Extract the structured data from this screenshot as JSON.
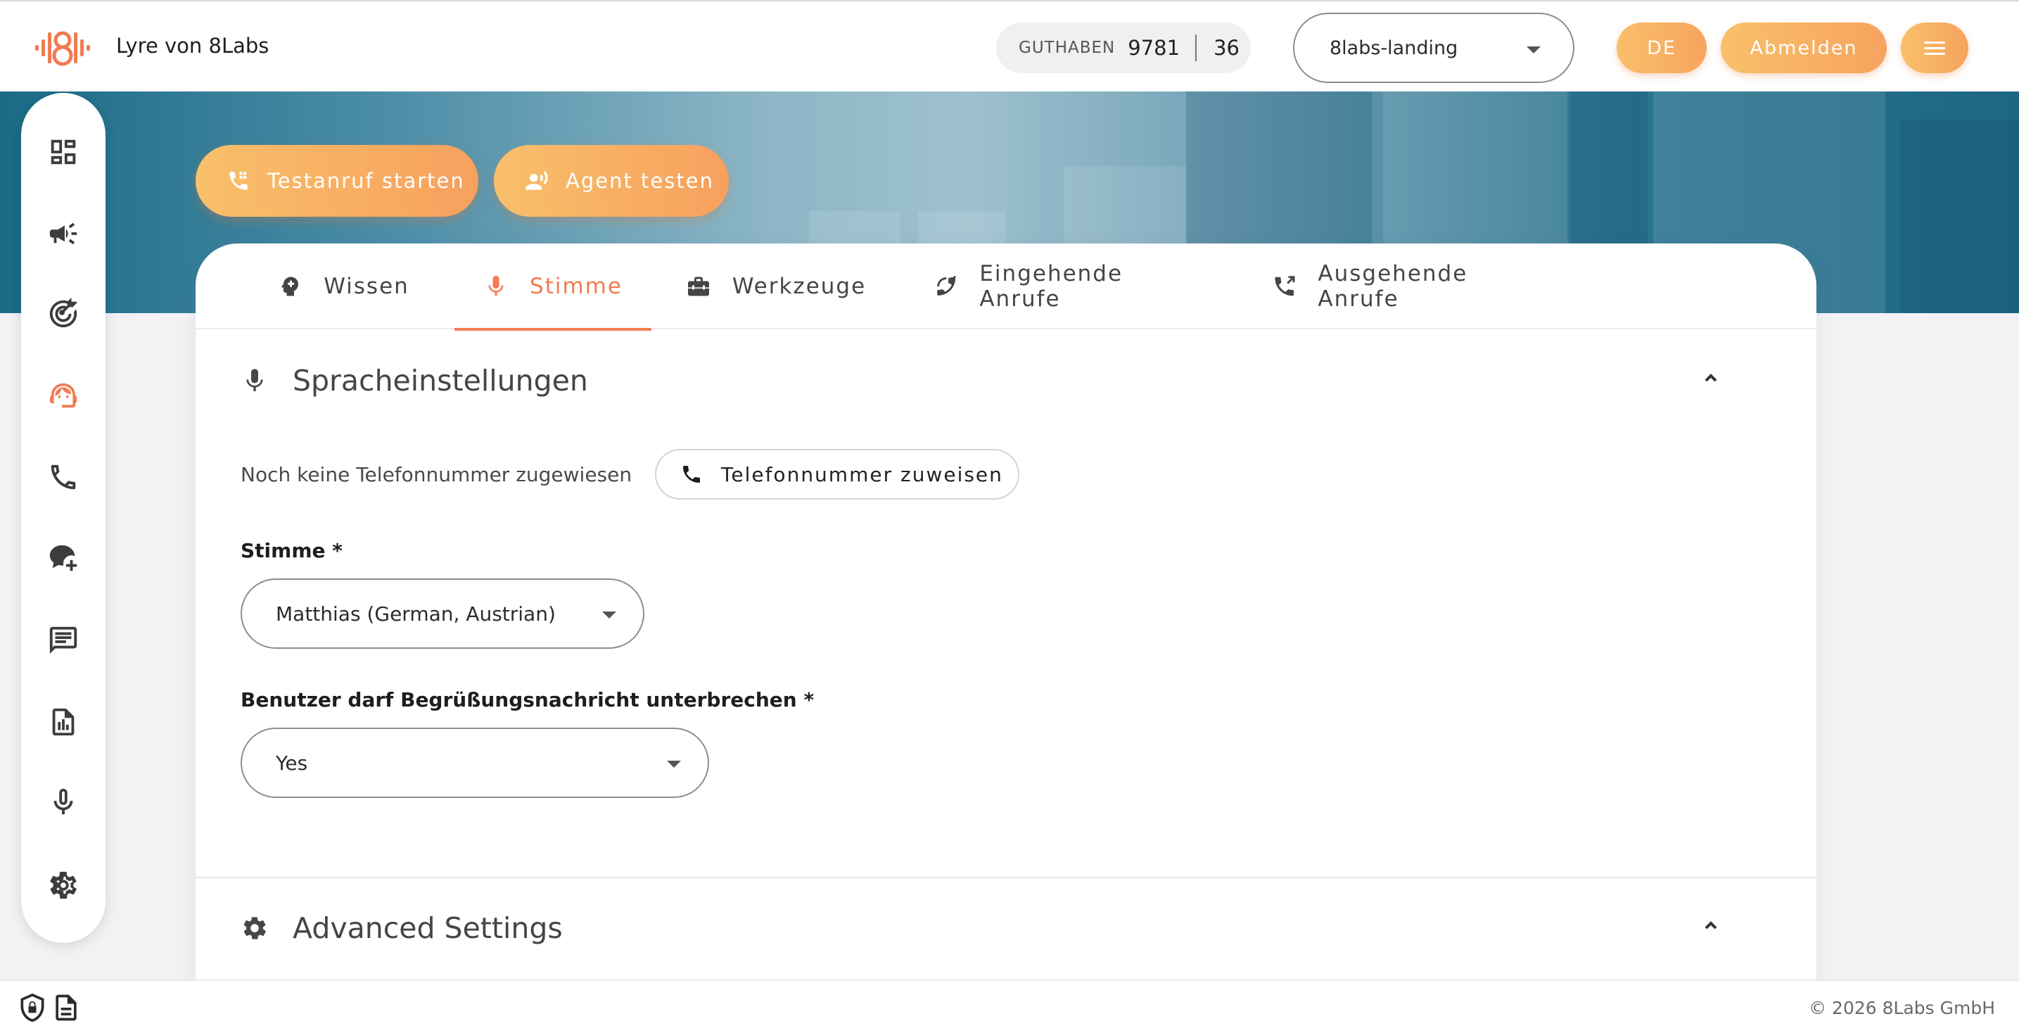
{
  "header": {
    "app_title": "Lyre von 8Labs",
    "balance_label": "GUTHABEN",
    "balance_value": "9781",
    "balance_secondary": "36",
    "project_selected": "8labs-landing",
    "lang_button": "DE",
    "logout_button": "Abmelden"
  },
  "actions": {
    "test_call": "Testanruf starten",
    "test_agent": "Agent testen"
  },
  "sidebar": {
    "items": [
      {
        "icon": "dashboard-icon"
      },
      {
        "icon": "megaphone-icon"
      },
      {
        "icon": "target-icon"
      },
      {
        "icon": "agent-face-icon",
        "active": true
      },
      {
        "icon": "phone-icon"
      },
      {
        "icon": "chat-add-icon"
      },
      {
        "icon": "message-icon"
      },
      {
        "icon": "report-icon"
      },
      {
        "icon": "microphone-icon"
      },
      {
        "icon": "gear-icon"
      }
    ]
  },
  "tabs": [
    {
      "label": "Wissen",
      "icon": "brain-icon"
    },
    {
      "label": "Stimme",
      "icon": "microphone-icon",
      "active": true
    },
    {
      "label": "Werkzeuge",
      "icon": "toolbox-icon"
    },
    {
      "label": "Eingehende Anrufe",
      "icon": "phone-incoming-icon"
    },
    {
      "label": "Ausgehende Anrufe",
      "icon": "phone-outgoing-icon"
    }
  ],
  "voice_settings": {
    "title": "Spracheinstellungen",
    "no_number_text": "Noch keine Telefonnummer zugewiesen",
    "assign_button": "Telefonnummer zuweisen",
    "voice_label": "Stimme *",
    "voice_value": "Matthias (German, Austrian)",
    "interrupt_label": "Benutzer darf Begrüßungsnachricht unterbrechen *",
    "interrupt_value": "Yes"
  },
  "advanced": {
    "title": "Advanced Settings"
  },
  "footer": {
    "copyright": "© 2026 8Labs GmbH"
  },
  "colors": {
    "accent": "#f37b52",
    "button_gradient_start": "#f8c06a",
    "button_gradient_end": "#f7a35f",
    "hero": "#4e8fa8"
  }
}
